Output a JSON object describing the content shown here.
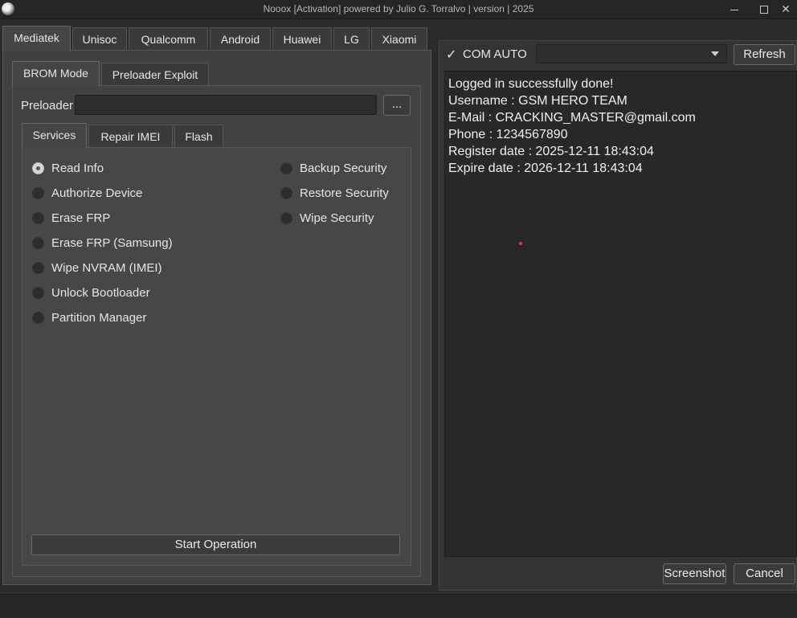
{
  "window": {
    "title": "Nooox [Activation] powered by Julio G. Torralvo  | version | 2025"
  },
  "top_tabs": [
    {
      "label": "Mediatek",
      "active": true
    },
    {
      "label": "Unisoc"
    },
    {
      "label": "Qualcomm"
    },
    {
      "label": "Android"
    },
    {
      "label": "Huawei"
    },
    {
      "label": "LG"
    },
    {
      "label": "Xiaomi"
    }
  ],
  "mode_tabs": [
    {
      "label": "BROM Mode",
      "active": true
    },
    {
      "label": "Preloader Exploit"
    }
  ],
  "preloader": {
    "label": "Preloader",
    "value": "",
    "browse_label": "..."
  },
  "service_tabs": [
    {
      "label": "Services",
      "active": true
    },
    {
      "label": "Repair IMEI"
    },
    {
      "label": "Flash"
    }
  ],
  "services_left": [
    {
      "label": "Read Info",
      "checked": true
    },
    {
      "label": "Authorize Device"
    },
    {
      "label": "Erase FRP"
    },
    {
      "label": "Erase FRP (Samsung)"
    },
    {
      "label": "Wipe NVRAM (IMEI)"
    },
    {
      "label": "Unlock Bootloader"
    },
    {
      "label": "Partition Manager"
    }
  ],
  "services_right": [
    {
      "label": "Backup Security"
    },
    {
      "label": "Restore Security"
    },
    {
      "label": "Wipe Security"
    }
  ],
  "start_button": "Start Operation",
  "com": {
    "checkmark": "✓",
    "label": "COM AUTO",
    "selected": "",
    "refresh_label": "Refresh"
  },
  "log": [
    "Logged in successfully done!",
    "",
    "Username : GSM HERO TEAM",
    "E-Mail : CRACKING_MASTER@gmail.com",
    "Phone : 1234567890",
    "Register date : 2025-12-11 18:43:04",
    "Expire date : 2026-12-11 18:43:04"
  ],
  "bottom_buttons": {
    "screenshot": "Screenshot",
    "cancel": "Cancel"
  }
}
